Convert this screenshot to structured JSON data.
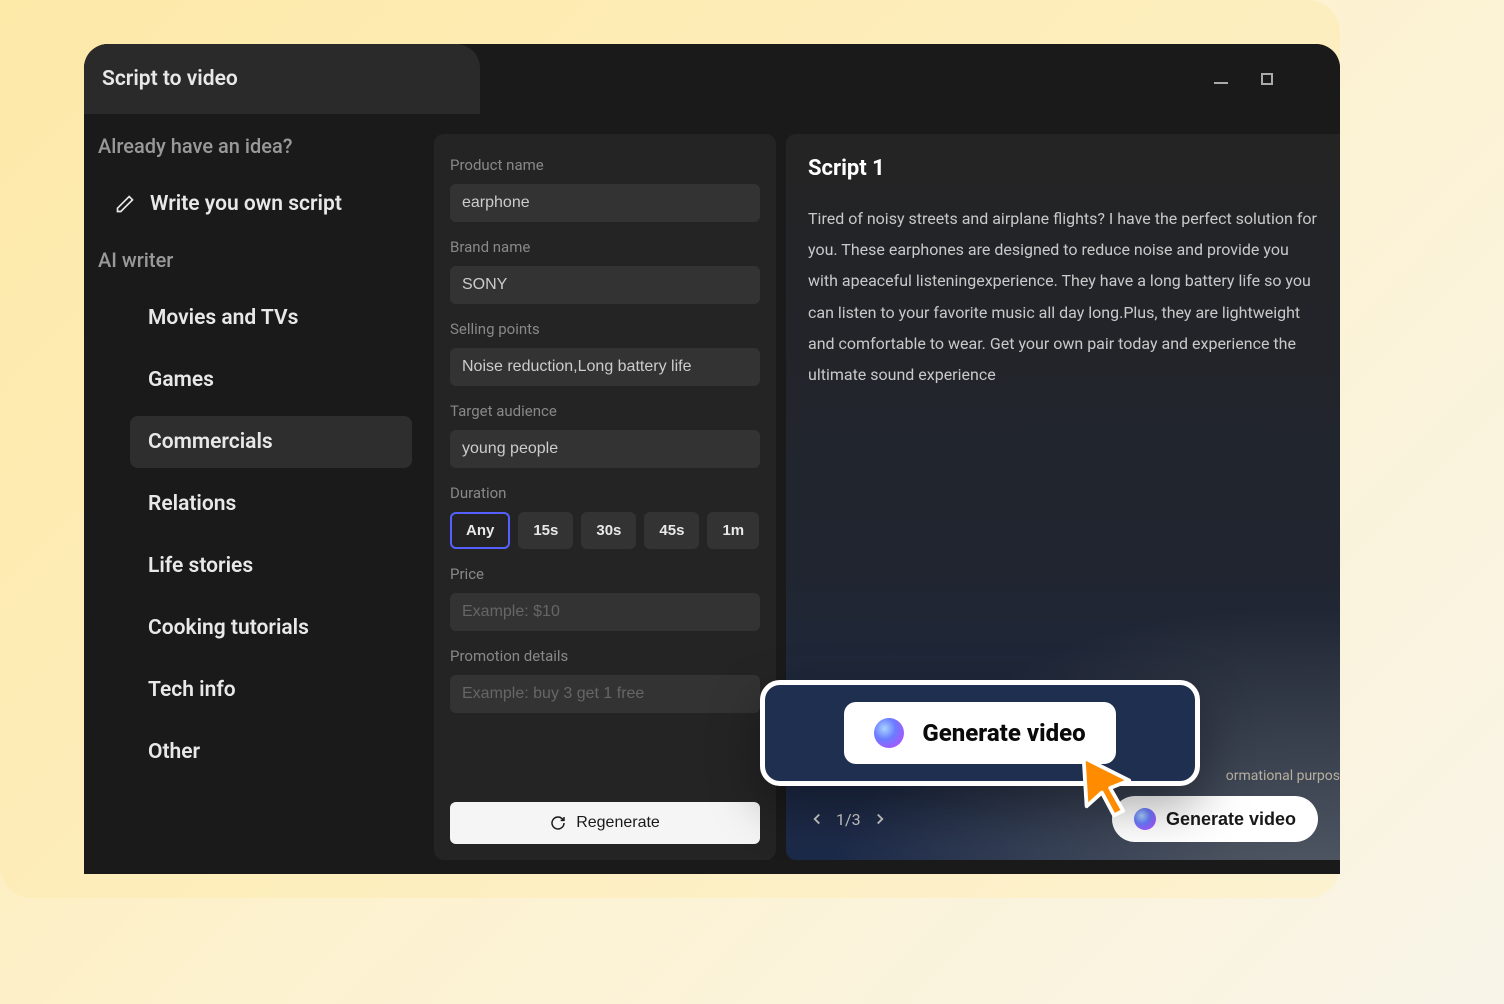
{
  "tab_title": "Script to video",
  "sidebar": {
    "idea_heading": "Already have an idea?",
    "write_own": "Write you own script",
    "ai_heading": "AI writer",
    "categories": [
      "Movies and TVs",
      "Games",
      "Commercials",
      "Relations",
      "Life stories",
      "Cooking tutorials",
      "Tech info",
      "Other"
    ],
    "active_index": 2
  },
  "form": {
    "product_name_label": "Product name",
    "product_name_value": "earphone",
    "brand_name_label": "Brand name",
    "brand_name_value": "SONY",
    "selling_points_label": "Selling points",
    "selling_points_value": "Noise reduction,Long battery life",
    "target_audience_label": "Target audience",
    "target_audience_value": "young people",
    "duration_label": "Duration",
    "duration_options": [
      "Any",
      "15s",
      "30s",
      "45s",
      "1m"
    ],
    "duration_active_index": 0,
    "price_label": "Price",
    "price_placeholder": "Example: $10",
    "promo_label": "Promotion details",
    "promo_placeholder": "Example: buy 3 get 1 free",
    "regenerate_label": "Regenerate"
  },
  "script": {
    "title": "Script 1",
    "body": "Tired of noisy streets and airplane flights? I have the perfect solution for you.\nThese earphones are designed to reduce noise and provide you with apeaceful listeningexperience. They have a long battery life so you can listen to your favorite music all day long.Plus, they are lightweight and comfortable to wear.\nGet your own pair today and experience the ultimate sound experience",
    "page_indicator": "1/3",
    "info_tag": "ormational purpos",
    "generate_label": "Generate video"
  },
  "float": {
    "label": "Generate video"
  },
  "colors": {
    "accent": "#5560ff"
  }
}
